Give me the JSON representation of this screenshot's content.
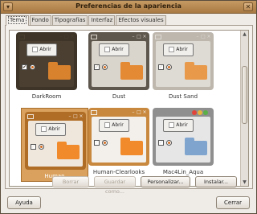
{
  "window": {
    "title": "Preferencias de la apariencia",
    "menu_glyph": "▾",
    "close_glyph": "✕"
  },
  "tabs": [
    {
      "label": "Tema"
    },
    {
      "label": "Fondo"
    },
    {
      "label": "Tipografías"
    },
    {
      "label": "Interfaz"
    },
    {
      "label": "Efectos visuales"
    }
  ],
  "themes": [
    {
      "name": "DarkRoom",
      "button": "Abrir",
      "frame": "#3e3528",
      "inner": "#4a3f30",
      "accent": "#d8822e",
      "selected": false
    },
    {
      "name": "Dust",
      "button": "Abrir",
      "frame": "#5e574d",
      "inner": "#d9d4cc",
      "accent": "#e48a34",
      "selected": false
    },
    {
      "name": "Dust Sand",
      "button": "Abrir",
      "frame": "#bdb7ae",
      "inner": "#dedad4",
      "accent": "#e89a4a",
      "selected": false
    },
    {
      "name": "Human",
      "button": "Abrir",
      "frame": "#b06d26",
      "inner": "#efe6dc",
      "accent": "#f08a2a",
      "selected": true
    },
    {
      "name": "Human-Clearlooks",
      "button": "Abrir",
      "frame": "#c8893f",
      "inner": "#f3efea",
      "accent": "#f08a2a",
      "selected": false
    },
    {
      "name": "Mac4Lin_Aqua",
      "button": "Abrir",
      "frame": "#8f8f8f",
      "inner": "#e6e6e6",
      "accent": "#7fa5cf",
      "selected": false
    }
  ],
  "actions": {
    "borrar": "Borrar",
    "guardar_como": "Guardar como...",
    "personalizar": "Personalizar...",
    "instalar": "Instalar..."
  },
  "footer": {
    "help": "Ayuda",
    "close": "Cerrar"
  },
  "scrollbar": {
    "up": "▲",
    "down": "▼"
  }
}
